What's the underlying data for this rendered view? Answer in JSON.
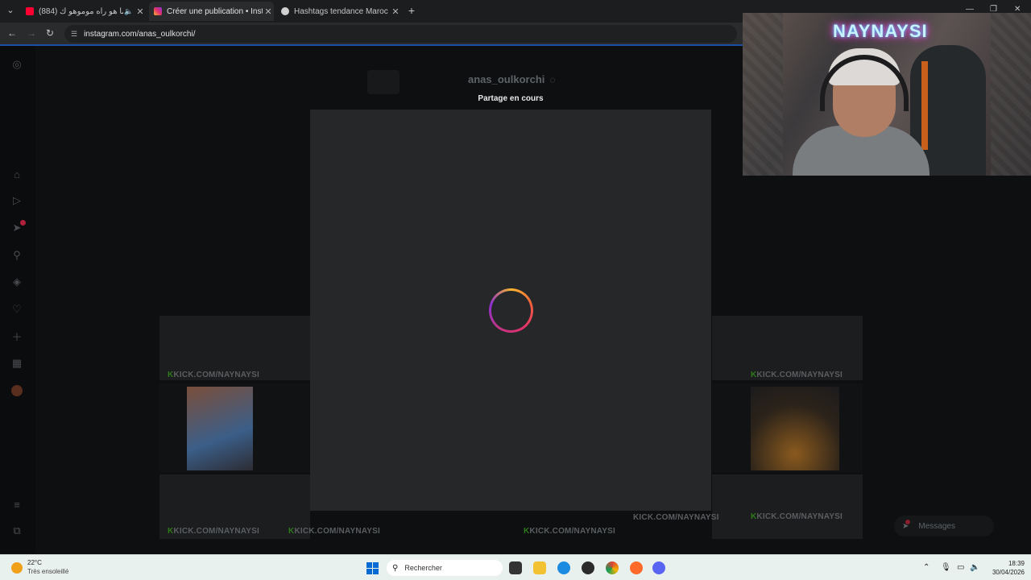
{
  "browser": {
    "tabs": [
      {
        "title": "(884) زعما هو راه موموهو ك",
        "icon": "youtube-icon",
        "color": "#ff0033",
        "active": false
      },
      {
        "title": "Créer une publication • Instagram",
        "icon": "instagram-icon",
        "color": "#e1306c",
        "active": true
      },
      {
        "title": "Hashtags tendance Maroc",
        "icon": "chatgpt-icon",
        "color": "#d0d0d0",
        "active": false
      }
    ],
    "new_tab_label": "+",
    "url": "instagram.com/anas_oulkorchi/"
  },
  "instagram": {
    "profile_name": "anas_oulkorchi",
    "modal_title": "Partage en cours",
    "messages_label": "Messages",
    "sidebar_icons": [
      "instagram-icon",
      "home-icon",
      "reels-icon",
      "direct-icon",
      "search-icon",
      "explore-icon",
      "notifications-icon",
      "create-icon",
      "dashboard-icon",
      "profile-icon",
      "menu-icon",
      "meta-icon"
    ],
    "grid_watermark": "KICK.COM/NAYNAYSI"
  },
  "stream_overlay": {
    "neon_sign": "NAYNAYSI"
  },
  "taskbar": {
    "temperature": "22°C",
    "condition": "Très ensoleillé",
    "search_placeholder": "Rechercher",
    "time": "18:39",
    "date": "30/04/2026"
  },
  "colors": {
    "accent_kick": "#53fc18",
    "instagram_gradient": [
      "#f9b52f",
      "#e1306c",
      "#8d2fd1"
    ],
    "windows_blue": "#0a6ad4"
  }
}
